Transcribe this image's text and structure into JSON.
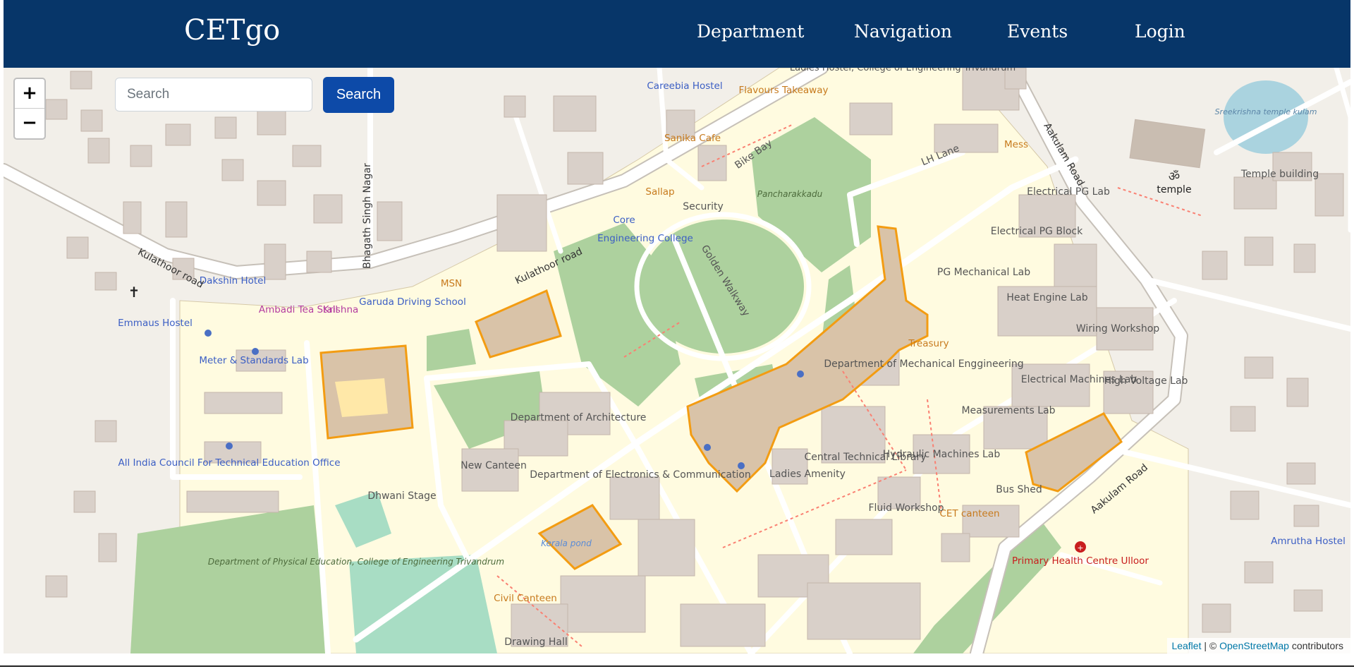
{
  "app": {
    "brand": "CETgo",
    "nav": [
      "Department",
      "Navigation",
      "Events",
      "Login"
    ]
  },
  "search": {
    "placeholder": "Search",
    "button_label": "Search"
  },
  "zoom": {
    "in_label": "+",
    "out_label": "−"
  },
  "attribution": {
    "leaflet": "Leaflet",
    "separator": " | © ",
    "osm": "OpenStreetMap",
    "suffix": " contributors"
  },
  "map_labels": {
    "blue": [
      "Careebia Hostel",
      "Dakshin Hotel",
      "Emmaus Hostel",
      "Garuda Driving School",
      "Engineering College",
      "Amrutha Hostel",
      "Meter & Standards Lab",
      "All India Council For Technical Education Office",
      "Core"
    ],
    "orange": [
      "Flavours Takeaway",
      "Sanika Cafe",
      "Sallap",
      "MSN",
      "Mess",
      "Treasury",
      "CET canteen",
      "Civil Canteen",
      "Kerala pond"
    ],
    "magenta": [
      "Ambadi Tea Stall",
      "Krishna"
    ],
    "gray": [
      "Ladies Hostel, College of Engineering Trivandrum",
      "LH Lane",
      "Bike Bay",
      "Pancharakkadu",
      "Security",
      "Golden Walkway",
      "Electrical PG Lab",
      "Electrical PG Block",
      "PG Mechanical Lab",
      "Heat Engine Lab",
      "Wiring Workshop",
      "Department of Mechanical Enggineering",
      "High Voltage Lab",
      "Electrical Machines Lab",
      "Measurements Lab",
      "Hydraulic Machines Lab",
      "Central Technical Library",
      "Ladies Amenity",
      "Fluid Workshop",
      "Bus Shed",
      "Department of Architecture",
      "New Canteen",
      "Department of Electronics & Communication",
      "Dhwani Stage",
      "Drawing Hall",
      "Temple building",
      "temple",
      "Department of Physical Education, College of Engineering Trivandrum",
      "Sreekrishna temple kulam"
    ],
    "roads": [
      "Kulathoor road",
      "Kulathoor road",
      "Bhagath Singh Nagar",
      "Aakulam Road",
      "Aakulam Road"
    ],
    "red": [
      "Primary Health Centre Ulloor"
    ]
  },
  "colors": {
    "navbar": "#073669",
    "map_bg": "#f2efe9",
    "campus": "#fffbe0",
    "park": "#add19e",
    "building": "#d9d0c9",
    "highlight": "#f5a623",
    "road": "#ffffff",
    "water": "#aad3df",
    "search_button": "#0d4aa8"
  }
}
